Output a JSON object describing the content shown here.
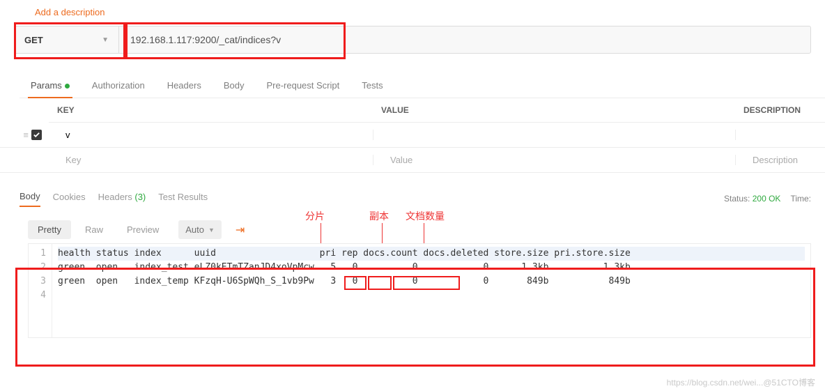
{
  "descLink": "Add a description",
  "request": {
    "method": "GET",
    "url": "192.168.1.117:9200/_cat/indices?v"
  },
  "reqTabs": {
    "params": "Params",
    "auth": "Authorization",
    "headers": "Headers",
    "body": "Body",
    "prereq": "Pre-request Script",
    "tests": "Tests"
  },
  "kvHeader": {
    "key": "KEY",
    "value": "VALUE",
    "desc": "DESCRIPTION"
  },
  "kvRow": {
    "key": "v",
    "value": ""
  },
  "kvPlaceholder": {
    "key": "Key",
    "value": "Value",
    "desc": "Description"
  },
  "respTabs": {
    "body": "Body",
    "cookies": "Cookies",
    "headers": "Headers",
    "headersCount": "(3)",
    "tests": "Test Results"
  },
  "status": {
    "label": "Status:",
    "value": "200 OK",
    "timeLabel": "Time:"
  },
  "annotations": {
    "shard": "分片",
    "replica": "副本",
    "docs": "文档数量"
  },
  "viewBar": {
    "pretty": "Pretty",
    "raw": "Raw",
    "preview": "Preview",
    "auto": "Auto"
  },
  "responseHeader": "health status index      uuid                   pri rep docs.count docs.deleted store.size pri.store.size",
  "responseRows": [
    "green  open   index_test eLZ0kETmTZanJD4xoVpMcw   5   0          0            0      1.3kb          1.3kb",
    "green  open   index_temp KFzqH-U6SpWQh_S_1vb9Pw   3   0          0            0       849b           849b"
  ],
  "lineNums": [
    "1",
    "2",
    "3",
    "4"
  ],
  "watermark": "https://blog.csdn.net/wei...@51CTO博客"
}
